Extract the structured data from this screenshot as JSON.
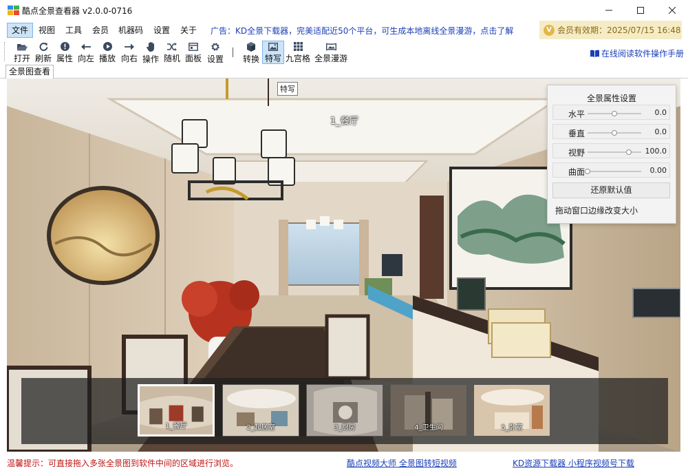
{
  "window": {
    "title": "酷点全景查看器 v2.0.0-0716",
    "controls": [
      "minimize-icon",
      "maximize-icon",
      "close-icon"
    ]
  },
  "menu": {
    "items": [
      "文件",
      "视图",
      "工具",
      "会员",
      "机器码",
      "设置",
      "关于"
    ],
    "active": "文件",
    "ad": "广告：KD全景下载器，完美适配近50个平台，可生成本地离线全景漫游，点击了解",
    "member": "会员有效期：2025/07/15 16:48"
  },
  "toolbar": {
    "buttons": [
      {
        "label": "打开",
        "icon": "folder-open-icon"
      },
      {
        "label": "刷新",
        "icon": "refresh-icon"
      },
      {
        "label": "属性",
        "icon": "info-icon"
      },
      {
        "label": "向左",
        "icon": "arrow-left-icon"
      },
      {
        "label": "播放",
        "icon": "play-icon"
      },
      {
        "label": "向右",
        "icon": "arrow-right-icon"
      },
      {
        "label": "操作",
        "icon": "hand-icon"
      },
      {
        "label": "随机",
        "icon": "shuffle-icon"
      },
      {
        "label": "面板",
        "icon": "panel-icon"
      },
      {
        "label": "设置",
        "icon": "gear-icon"
      },
      {
        "label": "转换",
        "icon": "cube-icon"
      },
      {
        "label": "特写",
        "icon": "image-icon",
        "pressed": true
      },
      {
        "label": "九宫格",
        "icon": "grid-icon"
      },
      {
        "label": "全景漫游",
        "icon": "panorama-icon"
      }
    ],
    "manual_link": "在线阅读软件操作手册"
  },
  "tabs": [
    "全景图查看"
  ],
  "viewer": {
    "tooltip": "特写",
    "scene_label": "1_餐厅"
  },
  "properties": {
    "title": "全景属性设置",
    "rows": [
      {
        "name": "水平",
        "value": "0.0",
        "level": 0.5
      },
      {
        "name": "垂直",
        "value": "0.0",
        "level": 0.5
      },
      {
        "name": "视野",
        "value": "100.0",
        "level": 0.77
      },
      {
        "name": "曲面",
        "value": "0.00",
        "level": 0.0
      }
    ],
    "reset": "还原默认值",
    "hint": "拖动窗口边缘改变大小"
  },
  "thumbnails": [
    {
      "label": "1_餐厅",
      "selected": true
    },
    {
      "label": "2_起居室",
      "selected": false
    },
    {
      "label": "3_厨房",
      "selected": false
    },
    {
      "label": "4_卫生间",
      "selected": false
    },
    {
      "label": "5_卧室",
      "selected": false
    }
  ],
  "status": {
    "tip": "温馨提示：可直接拖入多张全景图到软件中间的区域进行浏览。",
    "link1": "酷点视频大师 全景图转短视频",
    "link2": "KD资源下载器 小程序视频号下载"
  },
  "colors": {
    "link": "#1a3fb8",
    "status_tip": "#c01515",
    "member_bg": "#f5ecc5",
    "menu_active": "#cce4f7"
  }
}
